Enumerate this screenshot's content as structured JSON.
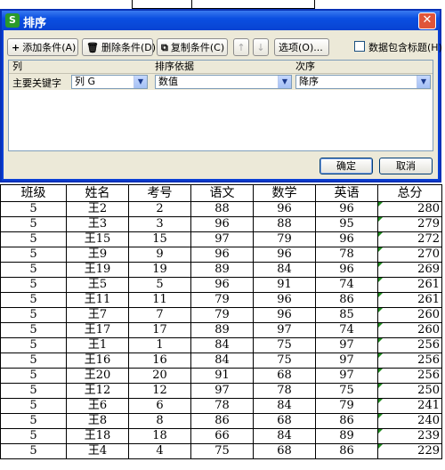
{
  "dialog": {
    "title": "排序",
    "toolbar": {
      "add": "添加条件(A)",
      "delete": "删除条件(D)",
      "copy": "复制条件(C)",
      "options": "选项(O)...",
      "has_header": "数据包含标题(H)"
    },
    "grid": {
      "headers": [
        "列",
        "排序依据",
        "次序"
      ],
      "row": {
        "label": "主要关键字",
        "column": "列 G",
        "sort_on": "数值",
        "order": "降序"
      }
    },
    "ok": "确定",
    "cancel": "取消"
  },
  "sheet": {
    "headers": [
      "班级",
      "姓名",
      "考号",
      "语文",
      "数学",
      "英语",
      "总分"
    ],
    "rows": [
      [
        "5",
        "王2",
        "2",
        "88",
        "96",
        "96",
        "280"
      ],
      [
        "5",
        "王3",
        "3",
        "96",
        "88",
        "95",
        "279"
      ],
      [
        "5",
        "王15",
        "15",
        "97",
        "79",
        "96",
        "272"
      ],
      [
        "5",
        "王9",
        "9",
        "96",
        "96",
        "78",
        "270"
      ],
      [
        "5",
        "王19",
        "19",
        "89",
        "84",
        "96",
        "269"
      ],
      [
        "5",
        "王5",
        "5",
        "96",
        "91",
        "74",
        "261"
      ],
      [
        "5",
        "王11",
        "11",
        "79",
        "96",
        "86",
        "261"
      ],
      [
        "5",
        "王7",
        "7",
        "79",
        "96",
        "85",
        "260"
      ],
      [
        "5",
        "王17",
        "17",
        "89",
        "97",
        "74",
        "260"
      ],
      [
        "5",
        "王1",
        "1",
        "84",
        "75",
        "97",
        "256"
      ],
      [
        "5",
        "王16",
        "16",
        "84",
        "75",
        "97",
        "256"
      ],
      [
        "5",
        "王20",
        "20",
        "91",
        "68",
        "97",
        "256"
      ],
      [
        "5",
        "王12",
        "12",
        "97",
        "78",
        "75",
        "250"
      ],
      [
        "5",
        "王6",
        "6",
        "78",
        "84",
        "79",
        "241"
      ],
      [
        "5",
        "王8",
        "8",
        "86",
        "68",
        "86",
        "240"
      ],
      [
        "5",
        "王18",
        "18",
        "66",
        "84",
        "89",
        "239"
      ],
      [
        "5",
        "王4",
        "4",
        "75",
        "68",
        "86",
        "229"
      ]
    ]
  }
}
